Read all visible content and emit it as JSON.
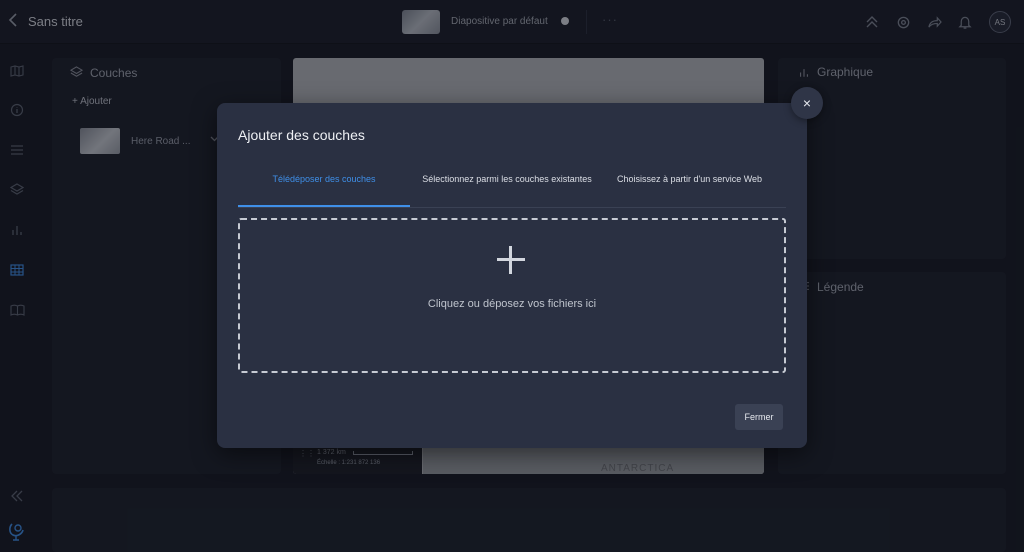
{
  "header": {
    "title": "Sans titre",
    "slide_name": "Diapositive par défaut",
    "more": "···",
    "avatar": "AS"
  },
  "left_panel": {
    "title": "Couches",
    "add_label": "+ Ajouter",
    "layers": [
      {
        "name": "Here Road ..."
      }
    ]
  },
  "right_panels": {
    "chart_title": "Graphique",
    "legend_title": "Légende"
  },
  "map": {
    "scale_distance": "1 372 km",
    "scale_text": "Échelle : 1:231 872 136",
    "continent_label": "ANTARCTICA"
  },
  "modal": {
    "title": "Ajouter des couches",
    "tabs": [
      {
        "label": "Télédéposer des couches",
        "active": true
      },
      {
        "label": "Sélectionnez parmi les couches existantes",
        "active": false
      },
      {
        "label": "Choisissez à partir d'un service Web",
        "active": false
      }
    ],
    "drop_text": "Cliquez ou déposez vos fichiers ici",
    "close_label": "Fermer",
    "close_icon": "×"
  },
  "colors": {
    "accent": "#3f8fe8",
    "background": "#161a25",
    "modal": "#2a3042"
  }
}
